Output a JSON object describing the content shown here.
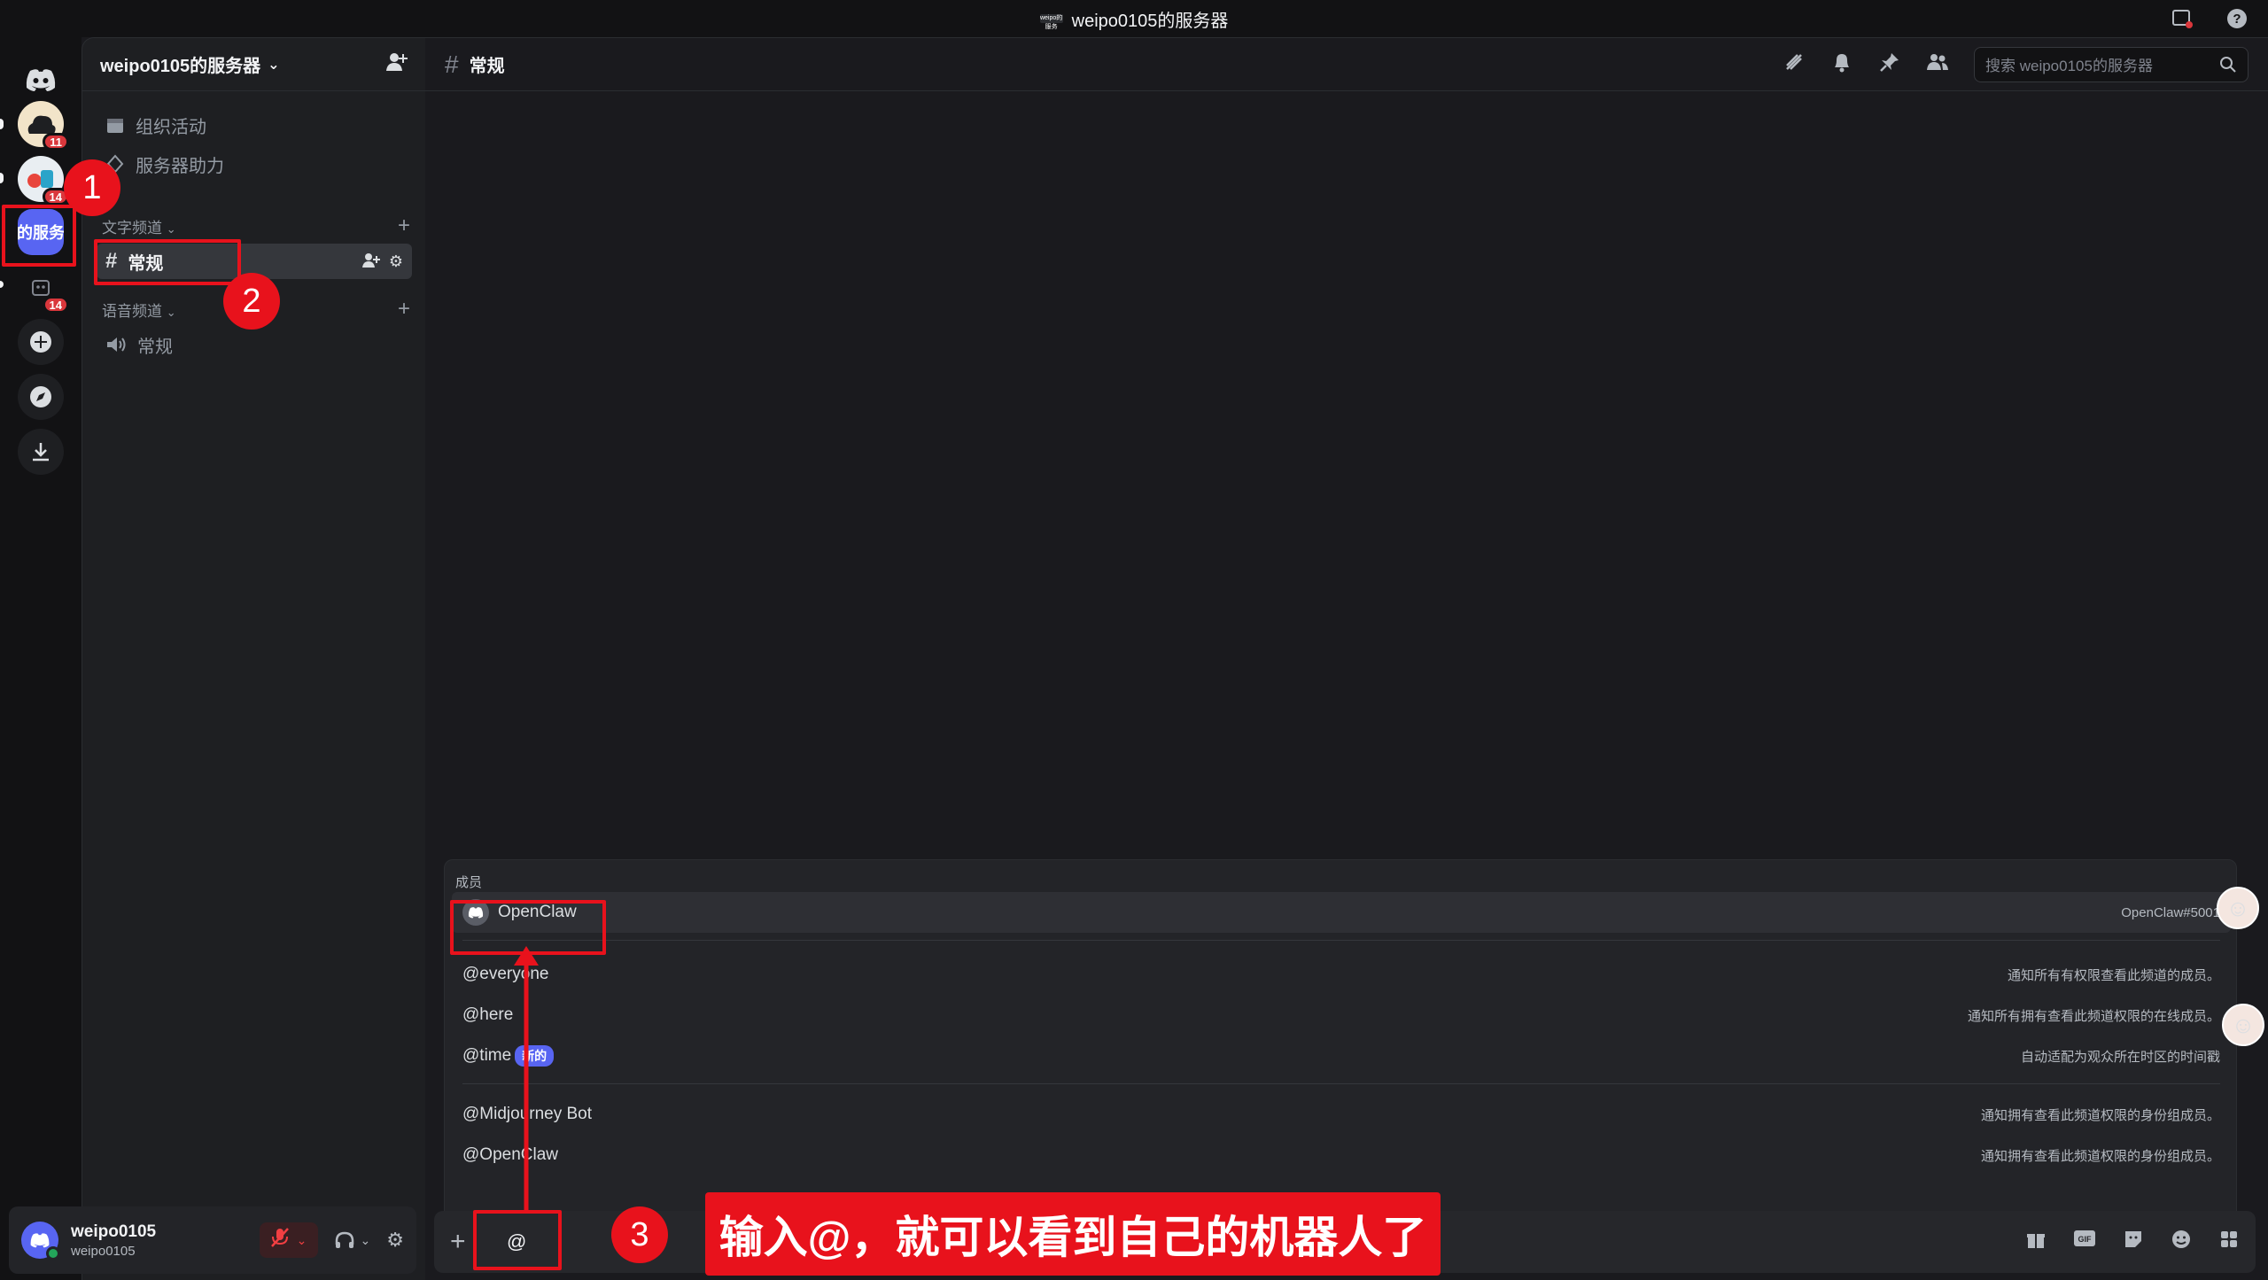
{
  "titlebar": {
    "logo_text": "weipo的服务",
    "title": "weipo0105的服务器"
  },
  "rail": {
    "active_server_label": "的服务",
    "badges": [
      "11",
      "14",
      "14"
    ]
  },
  "sidebar": {
    "server_name": "weipo0105的服务器",
    "events": "组织活动",
    "boost": "服务器助力",
    "text_category": "文字频道",
    "text_channel": "常规",
    "voice_category": "语音频道",
    "voice_channel": "常规"
  },
  "user": {
    "display_name": "weipo0105",
    "username": "weipo0105"
  },
  "main": {
    "channel_name": "常规",
    "search_placeholder": "搜索 weipo0105的服务器"
  },
  "autocomplete": {
    "section": "成员",
    "member": {
      "name": "OpenClaw",
      "tag": "OpenClaw#5001"
    },
    "rows": [
      {
        "label": "@everyone",
        "desc": "通知所有有权限查看此频道的成员。"
      },
      {
        "label": "@here",
        "desc": "通知所有拥有查看此频道权限的在线成员。"
      },
      {
        "label": "@time",
        "badge": "新的",
        "desc": "自动适配为观众所在时区的时间戳"
      },
      {
        "label": "@Midjourney Bot",
        "desc": "通知拥有查看此频道权限的身份组成员。"
      },
      {
        "label": "@OpenClaw",
        "desc": "通知拥有查看此频道权限的身份组成员。"
      }
    ]
  },
  "composer": {
    "value": "@"
  },
  "annotations": {
    "step1": "1",
    "step2": "2",
    "step3": "3",
    "callout": "输入@，就可以看到自己的机器人了",
    "color": "#e8121c"
  }
}
